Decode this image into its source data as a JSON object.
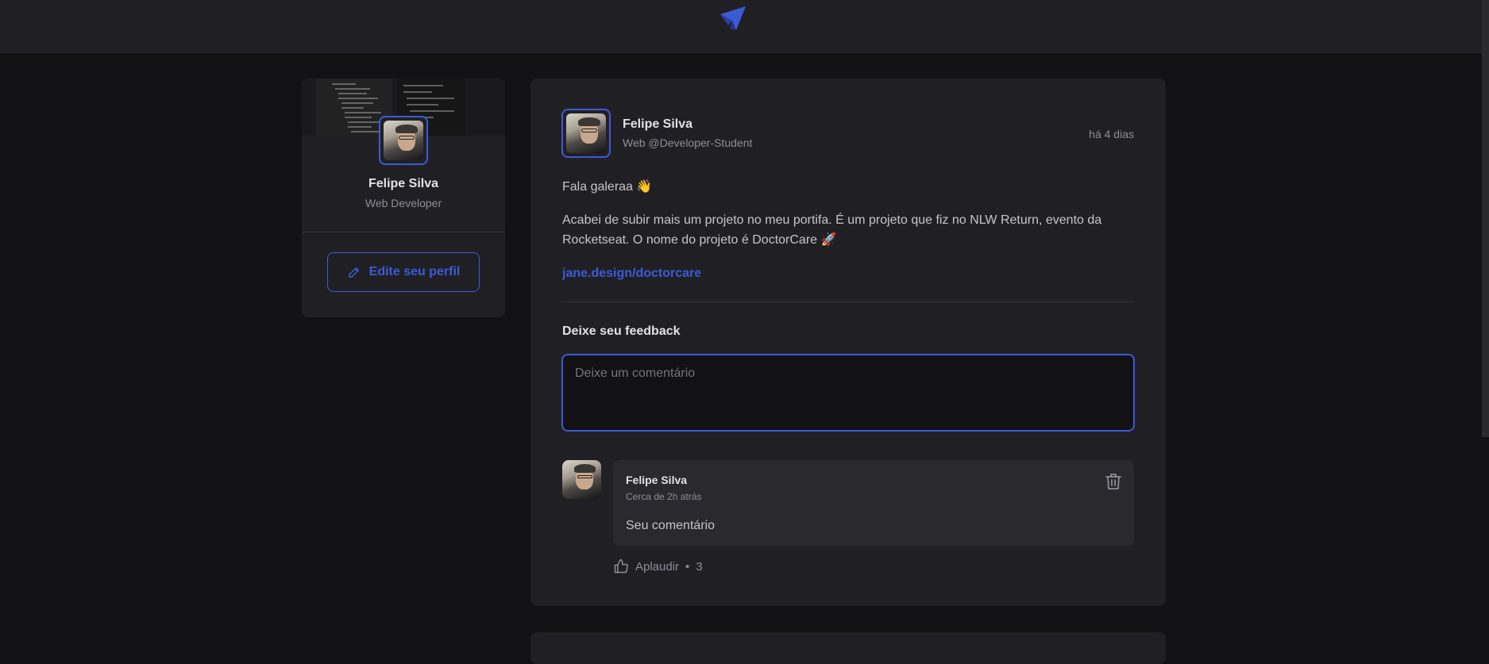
{
  "header": {
    "logo_icon": "paper-plane-logo-icon"
  },
  "sidebar": {
    "name": "Felipe Silva",
    "role": "Web Developer",
    "edit_button_label": "Edite seu perfil",
    "edit_icon": "pencil-icon"
  },
  "post": {
    "author_name": "Felipe Silva",
    "author_role": "Web @Developer-Student",
    "time": "há 4 dias",
    "paragraphs": [
      "Fala galeraa 👋",
      "Acabei de subir mais um projeto no meu portifa. É um projeto que fiz no NLW Return, evento da Rocketseat. O nome do projeto é DoctorCare 🚀"
    ],
    "link": "jane.design/doctorcare",
    "feedback_title": "Deixe seu feedback",
    "comment_placeholder": "Deixe um comentário"
  },
  "comment": {
    "author_name": "Felipe Silva",
    "time": "Cerca de 2h atrás",
    "text": "Seu comentário",
    "delete_icon": "trash-icon",
    "applaud_label": "Aplaudir",
    "applaud_separator": "•",
    "applaud_count": "3",
    "applaud_icon": "thumbs-up-icon"
  },
  "colors": {
    "accent": "#3d59d8",
    "background": "#121214",
    "panel": "#202024",
    "comment_panel": "#29292e"
  }
}
